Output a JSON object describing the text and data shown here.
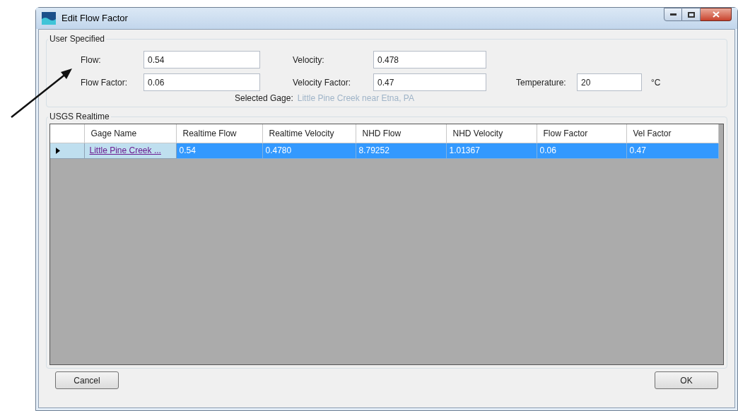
{
  "window": {
    "title": "Edit Flow Factor"
  },
  "user_specified": {
    "title": "User Specified",
    "fields": [
      {
        "label": "Flow:",
        "value": "0.54"
      },
      {
        "label": "Velocity:",
        "value": "0.478"
      },
      {
        "label": "Flow Factor:",
        "value": "0.06"
      },
      {
        "label": "Velocity Factor:",
        "value": "0.47"
      },
      {
        "label": "Temperature:",
        "value": "20",
        "unit": "°C"
      }
    ],
    "selected_gage": {
      "label": "Selected Gage:",
      "value": "Little Pine Creek near Etna, PA"
    }
  },
  "usgs_realtime": {
    "title": "USGS Realtime",
    "columns": [
      "Gage Name",
      "Realtime Flow",
      "Realtime Velocity",
      "NHD Flow",
      "NHD Velocity",
      "Flow Factor",
      "Vel Factor"
    ],
    "rows": [
      {
        "selected": true,
        "current": true,
        "cells": [
          "Little Pine Creek ...",
          "0.54",
          "0.4780",
          "8.79252",
          "1.01367",
          "0.06",
          "0.47"
        ]
      }
    ]
  },
  "buttons": [
    {
      "label": "Cancel"
    },
    {
      "label": "OK"
    }
  ]
}
